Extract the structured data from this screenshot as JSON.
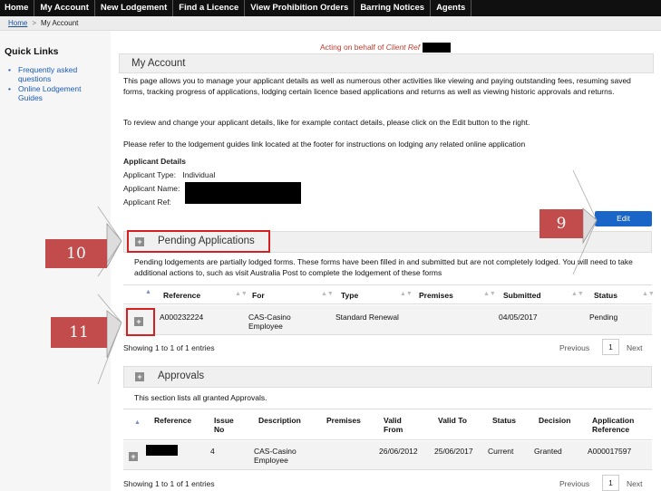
{
  "nav": [
    "Home",
    "My Account",
    "New Lodgement",
    "Find a Licence",
    "View Prohibition Orders",
    "Barring Notices",
    "Agents"
  ],
  "breadcrumb": {
    "home": "Home",
    "current": "My Account"
  },
  "sidebar": {
    "title": "Quick Links",
    "links": [
      "Frequently asked questions",
      "Online Lodgement Guides"
    ]
  },
  "acting": {
    "prefix": "Acting on behalf of",
    "client": "Client Ref"
  },
  "account": {
    "title": "My Account",
    "para1": "This page allows you to manage your applicant details as well as numerous other activities like viewing and paying outstanding fees, resuming saved forms, tracking progress of applications, lodging certain licence based applications and returns as well as viewing historic approvals and returns.",
    "para2": "To review and change your applicant details, like for example contact details, please click on the Edit button to the right.",
    "para3": "Please refer to the lodgement guides link located at the footer for instructions on lodging any related online application",
    "details_title": "Applicant Details",
    "type_label": "Applicant Type:",
    "type_value": "Individual",
    "name_label": "Applicant Name:",
    "ref_label": "Applicant Ref:",
    "edit_label": "Edit"
  },
  "pending": {
    "title": "Pending Applications",
    "description": "Pending lodgements are partially lodged forms. These forms have been filled in and submitted but are not completely lodged. You will need to take additional actions to, such as visit Australia Post to complete the lodgement of these forms",
    "columns": [
      "Reference",
      "For",
      "Type",
      "Premises",
      "Submitted",
      "Status"
    ],
    "rows": [
      {
        "reference": "A000232224",
        "for_line1": "CAS-Casino",
        "for_line2": "Employee",
        "type": "Standard Renewal",
        "premises": "",
        "submitted": "04/05/2017",
        "status": "Pending"
      }
    ],
    "info": "Showing 1 to 1 of 1 entries",
    "prev": "Previous",
    "page": "1",
    "next": "Next"
  },
  "approvals": {
    "title": "Approvals",
    "description": "This section lists all granted Approvals.",
    "columns": {
      "reference": "Reference",
      "issue_no_1": "Issue",
      "issue_no_2": "No",
      "description": "Description",
      "premises": "Premises",
      "valid_from_1": "Valid",
      "valid_from_2": "From",
      "valid_to": "Valid To",
      "status": "Status",
      "decision": "Decision",
      "app_ref_1": "Application",
      "app_ref_2": "Reference"
    },
    "rows": [
      {
        "issue_no": "4",
        "desc_line1": "CAS-Casino",
        "desc_line2": "Employee",
        "premises": "",
        "valid_from": "26/06/2012",
        "valid_to": "25/06/2017",
        "status": "Current",
        "decision": "Granted",
        "app_ref": "A000017597"
      }
    ],
    "info": "Showing 1 to 1 of 1 entries",
    "prev": "Previous",
    "page": "1",
    "next": "Next"
  },
  "callouts": [
    "9",
    "10",
    "11"
  ],
  "colors": {
    "nav_bg": "#101010",
    "button_blue": "#1a66c8",
    "callout_red": "#c24b4b",
    "highlight_red": "#d42020",
    "link_blue": "#1a5bb5"
  }
}
